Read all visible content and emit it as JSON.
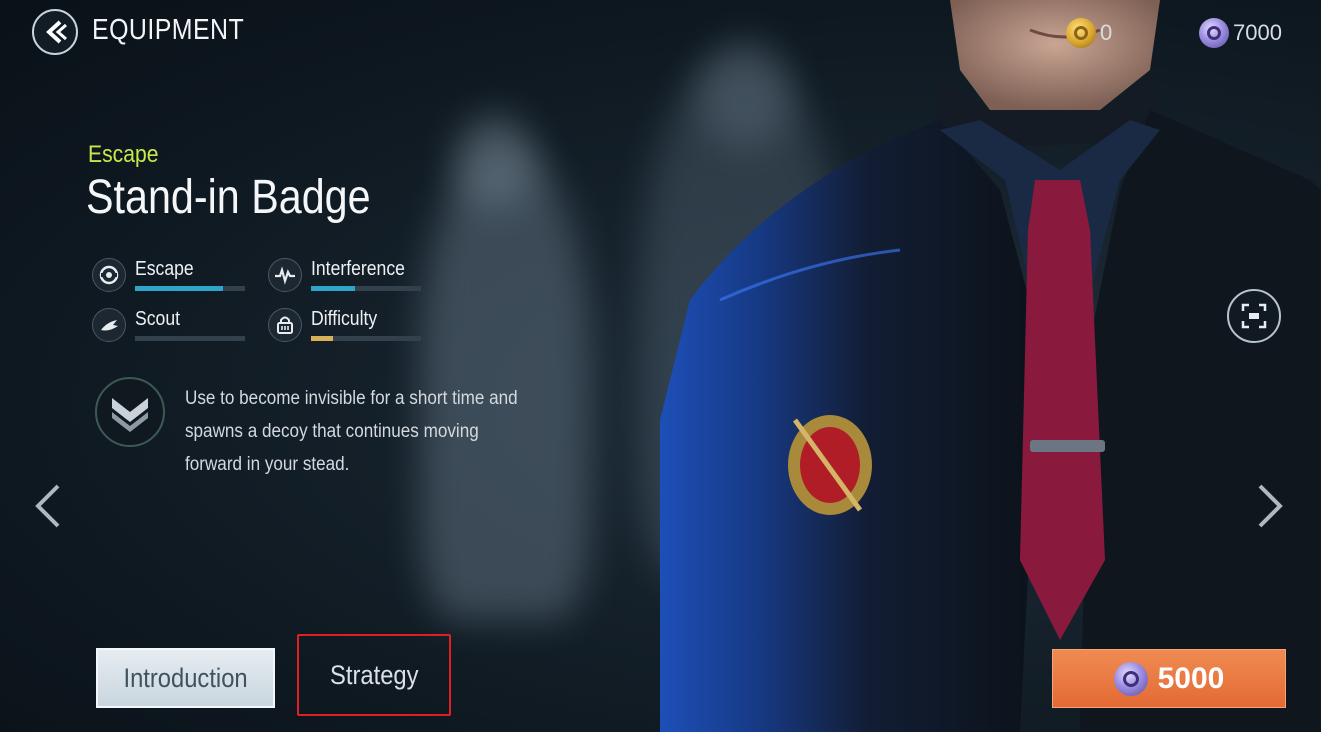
{
  "header": {
    "title": "EQUIPMENT"
  },
  "currencies": {
    "gold": "0",
    "crystal": "7000"
  },
  "item": {
    "category": "Escape",
    "name": "Stand-in Badge",
    "description": "Use to become invisible for a short time and spawns a decoy that continues moving forward in your stead."
  },
  "stats": [
    {
      "label": "Escape",
      "level": 0.8,
      "color": "#2fa6c9",
      "icon": "escape-icon"
    },
    {
      "label": "Interference",
      "level": 0.4,
      "color": "#2fa6c9",
      "icon": "interference-icon"
    },
    {
      "label": "Scout",
      "level": 0.0,
      "color": "#2fa6c9",
      "icon": "scout-icon"
    },
    {
      "label": "Difficulty",
      "level": 0.2,
      "color": "#d8b15a",
      "icon": "difficulty-icon"
    }
  ],
  "tabs": {
    "introduction": "Introduction",
    "strategy": "Strategy"
  },
  "purchase": {
    "price": "5000"
  },
  "colors": {
    "accent_green": "#c7e84a",
    "buy_orange": "#e8773f",
    "highlight_red": "#e02020"
  }
}
